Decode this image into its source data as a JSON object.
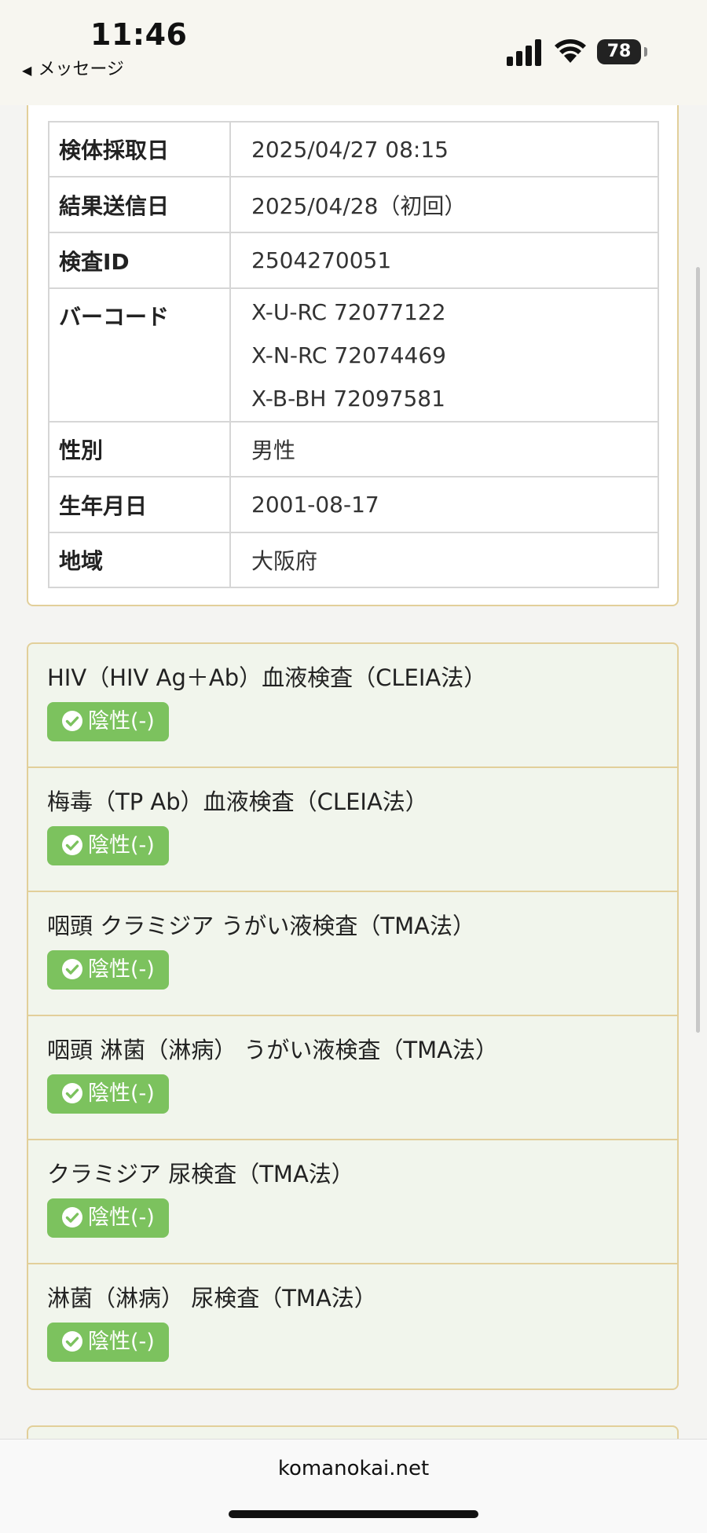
{
  "status_bar": {
    "time": "11:46",
    "back_label": "メッセージ",
    "battery": "78"
  },
  "info": {
    "rows": [
      {
        "label": "検体採取日",
        "value": "2025/04/27  08:15"
      },
      {
        "label": "結果送信日",
        "value": "2025/04/28（初回）"
      },
      {
        "label": "検査ID",
        "value": "2504270051"
      },
      {
        "label": "バーコード",
        "values": [
          "X-U-RC  72077122",
          "X-N-RC  72074469",
          "X-B-BH  72097581"
        ]
      },
      {
        "label": "性別",
        "value": "男性"
      },
      {
        "label": "生年月日",
        "value": "2001-08-17"
      },
      {
        "label": "地域",
        "value": "大阪府"
      }
    ]
  },
  "results": [
    {
      "title": "HIV（HIV Ag＋Ab）血液検査（CLEIA法）",
      "status": "陰性(-)"
    },
    {
      "title": "梅毒（TP Ab）血液検査（CLEIA法）",
      "status": "陰性(-)"
    },
    {
      "title": "咽頭 クラミジア うがい液検査（TMA法）",
      "status": "陰性(-)"
    },
    {
      "title": "咽頭 淋菌（淋病） うがい液検査（TMA法）",
      "status": "陰性(-)"
    },
    {
      "title": "クラミジア 尿検査（TMA法）",
      "status": "陰性(-)"
    },
    {
      "title": "淋菌（淋病） 尿検査（TMA法）",
      "status": "陰性(-)"
    }
  ],
  "browser": {
    "url": "komanokai.net"
  },
  "colors": {
    "negative_badge": "#7cc25e",
    "card_border": "#e2cf9a",
    "result_bg": "#f1f5ec"
  },
  "icons": [
    "back-arrow-icon",
    "signal-icon",
    "wifi-icon",
    "battery-icon",
    "check-circle-icon"
  ]
}
